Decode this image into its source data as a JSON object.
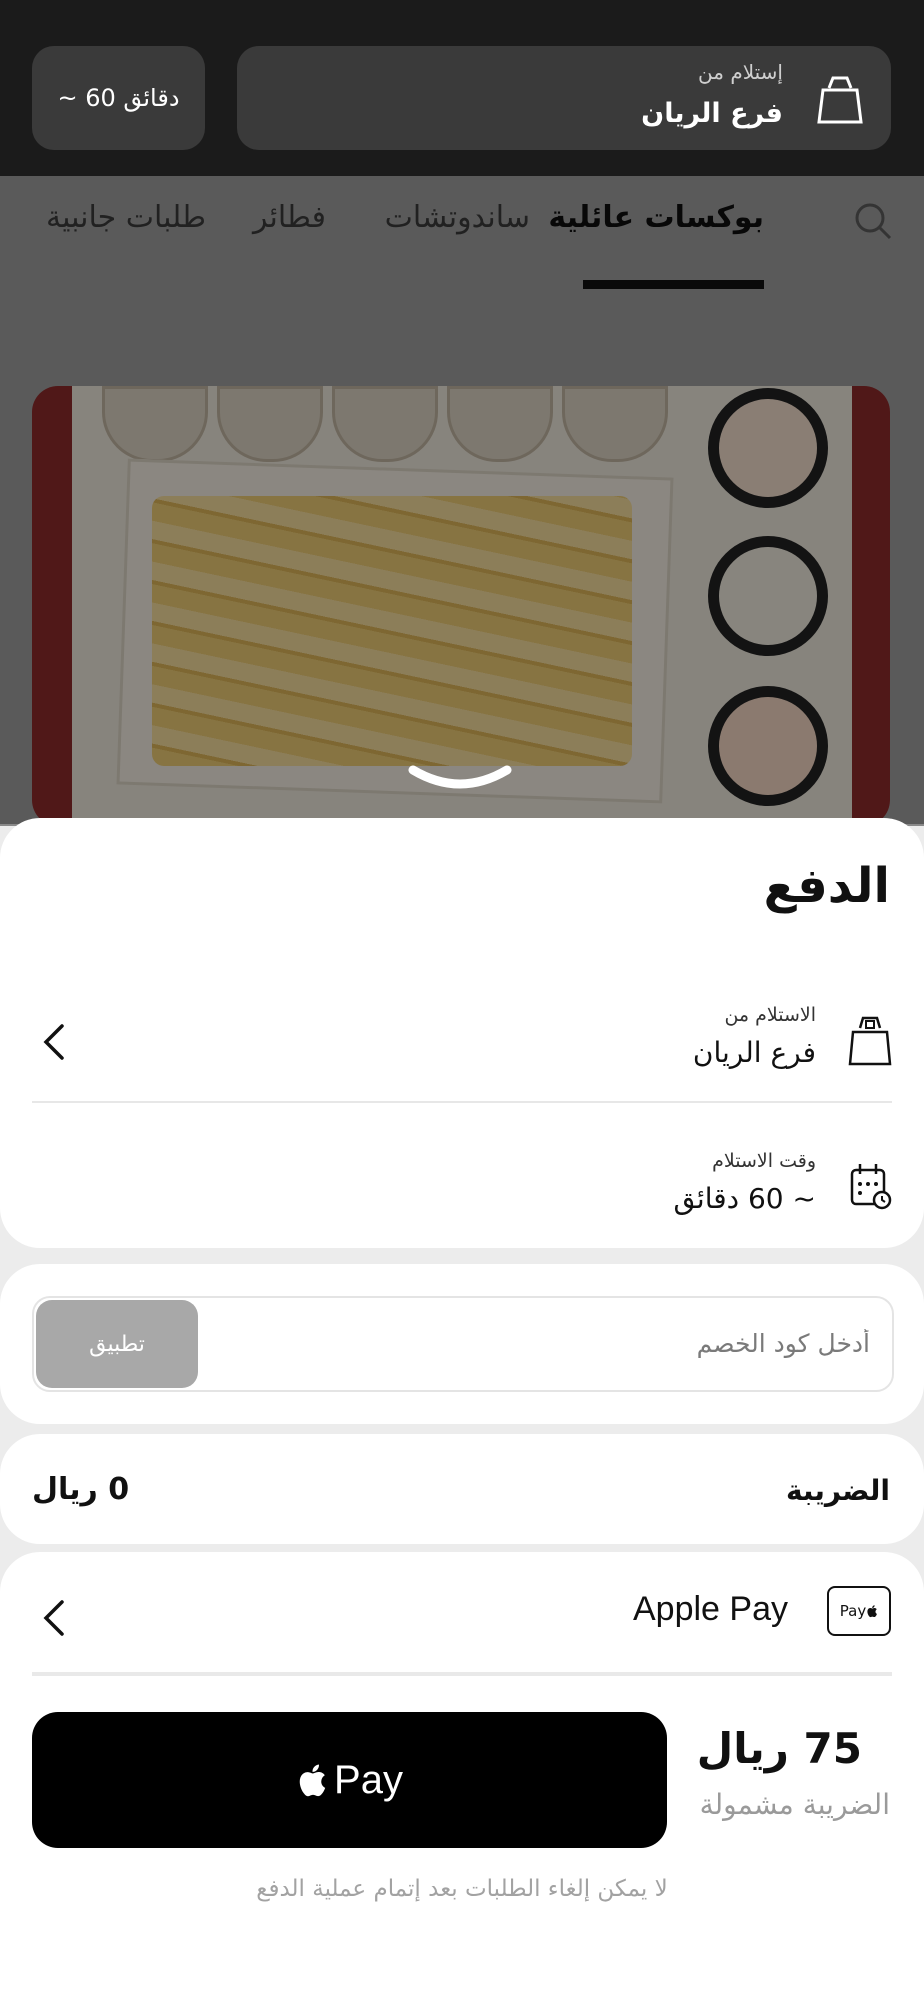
{
  "header": {
    "pickup_label": "إستلام من",
    "branch_name": "فرع الريان",
    "time_estimate": "~ 60 دقائق"
  },
  "categories": {
    "items": [
      "بوكسات عائلية",
      "ساندوتشات",
      "فطائر",
      "طلبات جانبية"
    ],
    "active_index": 0
  },
  "sheet": {
    "title": "الدفع",
    "pickup_row": {
      "label": "الاستلام من",
      "value": "فرع الريان"
    },
    "time_row": {
      "label": "وقت الاستلام",
      "value": "~ 60 دقائق"
    },
    "coupon": {
      "placeholder": "أدخل كود الخصم",
      "apply_label": "تطبيق"
    },
    "tax": {
      "label": "الضريبة",
      "value": "0 ريال"
    },
    "payment_method": {
      "badge": "Pay",
      "name": "Apple Pay"
    },
    "total": {
      "amount": "75 ريال",
      "note": "الضريبة مشمولة"
    },
    "pay_button_label": "Pay",
    "notice": "لا يمكن إلغاء الطلبات بعد إتمام عملية الدفع"
  },
  "colors": {
    "topbar": "#1b1b1b",
    "pay_button": "#000000",
    "apply_disabled": "#a8a8a8"
  }
}
